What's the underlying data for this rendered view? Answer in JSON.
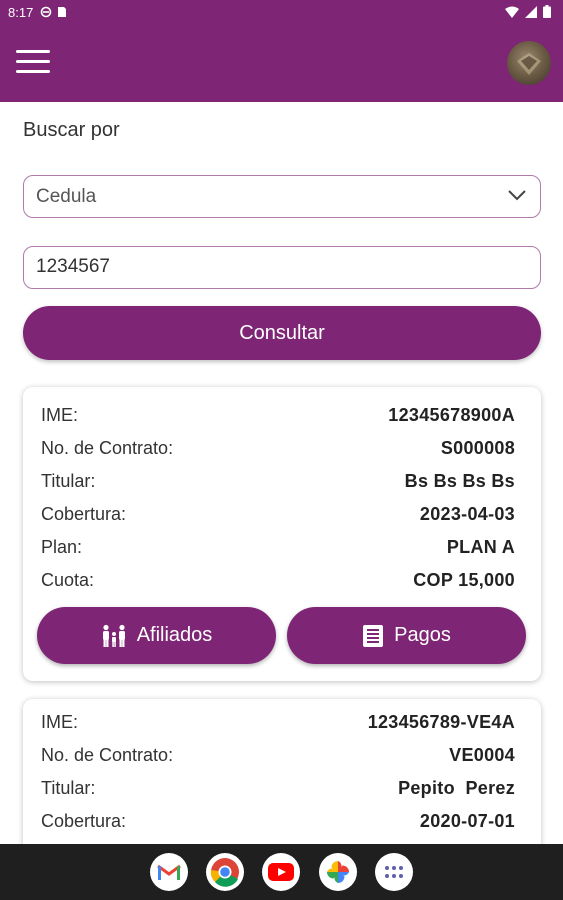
{
  "status_bar": {
    "time": "8:17"
  },
  "search": {
    "label": "Buscar por",
    "type_selected": "Cedula",
    "value": "1234567",
    "submit_label": "Consultar"
  },
  "results": [
    {
      "rows": [
        {
          "label": "IME:",
          "value": "12345678900A"
        },
        {
          "label": "No. de Contrato:",
          "value": "S000008"
        },
        {
          "label": "Titular:",
          "value": "Bs Bs Bs Bs"
        },
        {
          "label": "Cobertura:",
          "value": "2023-04-03"
        },
        {
          "label": "Plan:",
          "value": "PLAN A"
        },
        {
          "label": "Cuota:",
          "value": "COP 15,000"
        }
      ],
      "afiliados_label": "Afiliados",
      "pagos_label": "Pagos"
    },
    {
      "rows": [
        {
          "label": "IME:",
          "value": "123456789-VE4A"
        },
        {
          "label": "No. de Contrato:",
          "value": "VE0004"
        },
        {
          "label": "Titular:",
          "value": "Pepito  Perez"
        },
        {
          "label": "Cobertura:",
          "value": "2020-07-01"
        }
      ]
    }
  ],
  "dock_icons": [
    "gmail-icon",
    "chrome-icon",
    "youtube-icon",
    "photos-icon",
    "app-drawer-icon"
  ],
  "colors": {
    "primary": "#7e2576",
    "border": "#b07aab"
  }
}
